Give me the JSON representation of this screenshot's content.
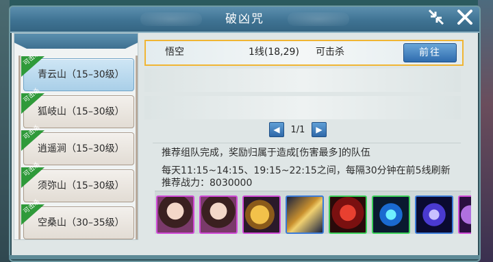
{
  "window": {
    "title": "破凶咒"
  },
  "sidebar": {
    "badge_text": "可击杀",
    "items": [
      {
        "label": "青云山（15–30级）",
        "selected": true,
        "killable": true
      },
      {
        "label": "狐岐山（15–30级）",
        "selected": false,
        "killable": true
      },
      {
        "label": "逍遥涧（15–30级）",
        "selected": false,
        "killable": true
      },
      {
        "label": "须弥山（15–30级）",
        "selected": false,
        "killable": true
      },
      {
        "label": "空桑山（30–35级）",
        "selected": false,
        "killable": true
      }
    ]
  },
  "list": {
    "rows": [
      {
        "name": "悟空",
        "line": "1线(18,29)",
        "status": "可击杀",
        "action": "前往"
      }
    ]
  },
  "pager": {
    "text": "1/1"
  },
  "info": {
    "line1": "推荐组队完成，奖励归属于造成[伤害最多]的队伍",
    "line2": "每天11:15~14:15、19:15~22:15之间，每隔30分钟在前5线刷新",
    "line3": "推荐战力：8030000"
  },
  "rewards": [
    {
      "icon": "character-portrait-icon",
      "border": "#d04ad8"
    },
    {
      "icon": "character-portrait-fragment-icon",
      "border": "#d04ad8"
    },
    {
      "icon": "gold-coins-icon",
      "border": "#d04ad8"
    },
    {
      "icon": "scroll-item-icon",
      "border": "#3a7ad8"
    },
    {
      "icon": "red-skill-book-icon",
      "border": "#3bd05a"
    },
    {
      "icon": "cyan-gem-icon",
      "border": "#3bd05a"
    },
    {
      "icon": "purple-gem-icon",
      "border": "#3a7ad8"
    },
    {
      "icon": "partial-item-icon",
      "border": "#d04ad8"
    }
  ],
  "colors": {
    "accent": "#f0b533",
    "title_bar": "#3f7393",
    "badge": "#2f9a3a",
    "button": "#2f6cae"
  }
}
